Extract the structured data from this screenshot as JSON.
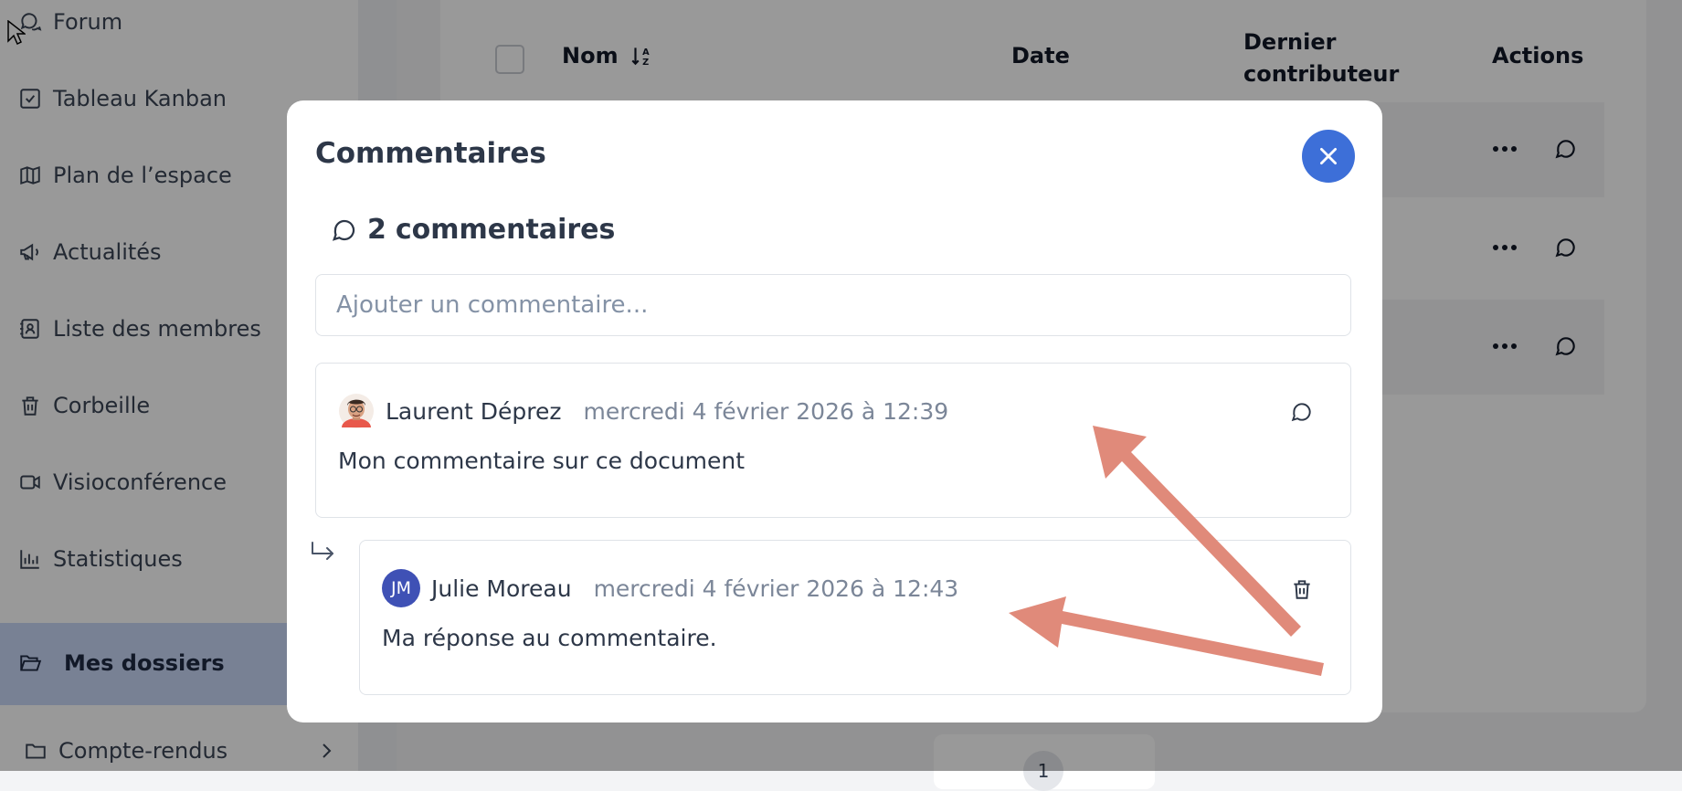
{
  "sidebar": {
    "items": [
      {
        "label": "Forum",
        "icon": "chat-icon"
      },
      {
        "label": "Tableau Kanban",
        "icon": "checkbox-icon"
      },
      {
        "label": "Plan de l’espace",
        "icon": "map-icon"
      },
      {
        "label": "Actualités",
        "icon": "megaphone-icon"
      },
      {
        "label": "Liste des membres",
        "icon": "contact-book-icon"
      },
      {
        "label": "Corbeille",
        "icon": "trash-icon"
      },
      {
        "label": "Visioconférence",
        "icon": "video-icon"
      },
      {
        "label": "Statistiques",
        "icon": "bar-chart-icon"
      }
    ],
    "active": {
      "label": "Mes dossiers",
      "icon": "folder-open-icon"
    },
    "sub": {
      "label": "Compte-rendus",
      "icon": "folder-icon"
    }
  },
  "table": {
    "headers": {
      "name": "Nom",
      "date": "Date",
      "last_contributor_line1": "Dernier",
      "last_contributor_line2": "contributeur",
      "actions": "Actions"
    }
  },
  "pagination": {
    "current": "1"
  },
  "modal": {
    "title": "Commentaires",
    "count_number": "2",
    "count_label": "commentaires",
    "input_placeholder": "Ajouter un commentaire...",
    "comments": [
      {
        "author": "Laurent Déprez",
        "date": "mercredi 4 février 2026 à 12:39",
        "body": "Mon commentaire sur ce document",
        "action_icon": "reply-icon"
      },
      {
        "author": "Julie Moreau",
        "initials": "JM",
        "date": "mercredi 4 février 2026 à 12:43",
        "body": "Ma réponse au commentaire.",
        "action_icon": "trash-icon",
        "is_reply": true
      }
    ]
  },
  "colors": {
    "accent": "#3d6fd8",
    "avatar_bg": "#3f51b5",
    "annotation_arrow": "#e08a7a",
    "active_sidebar": "#c9d7f7"
  }
}
